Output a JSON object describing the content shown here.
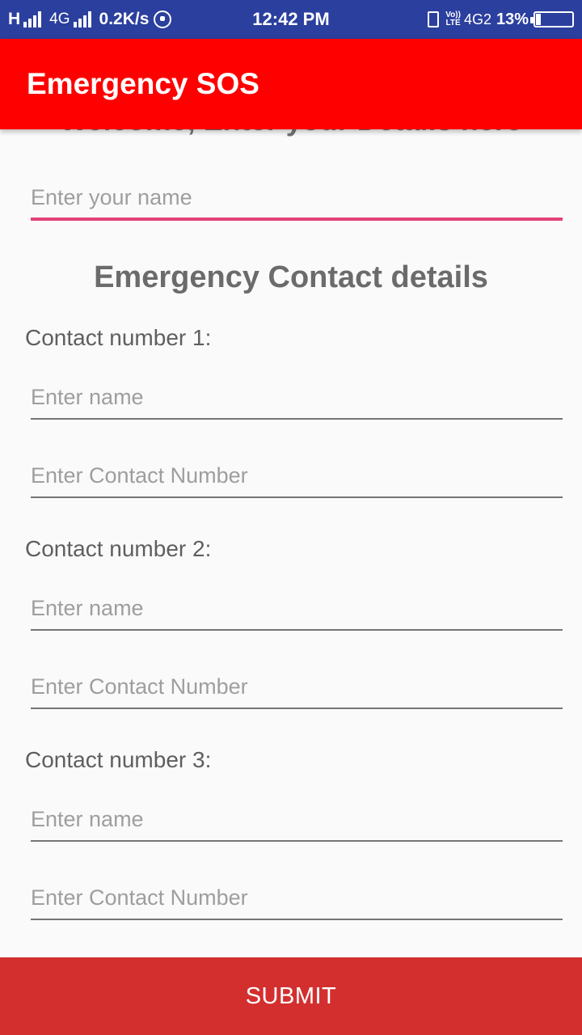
{
  "status_bar": {
    "network_1": "H",
    "network_2": "4G",
    "speed": "0.2K/s",
    "time": "12:42 PM",
    "lte_top": "Vo))",
    "lte_bottom": "LTE",
    "network_3": "4G2",
    "battery_text": "13%",
    "battery_level": 0.13
  },
  "app_bar": {
    "title": "Emergency SOS"
  },
  "form": {
    "welcome_heading": "Welcome, Enter your Details here",
    "name_placeholder": "Enter your name",
    "section_title": "Emergency Contact details",
    "contacts": [
      {
        "label": "Contact number 1:",
        "name_placeholder": "Enter name",
        "number_placeholder": "Enter Contact Number"
      },
      {
        "label": "Contact number 2:",
        "name_placeholder": "Enter name",
        "number_placeholder": "Enter Contact Number"
      },
      {
        "label": "Contact number 3:",
        "name_placeholder": "Enter name",
        "number_placeholder": "Enter Contact Number"
      }
    ],
    "submit_label": "SUBMIT"
  },
  "colors": {
    "status_bar": "#2b3f9e",
    "app_bar": "#ff0000",
    "focus_underline": "#e44276",
    "submit": "#d32f2f"
  },
  "icons": [
    "signal-icon",
    "whatsapp-icon",
    "vibrate-icon",
    "battery-icon"
  ]
}
